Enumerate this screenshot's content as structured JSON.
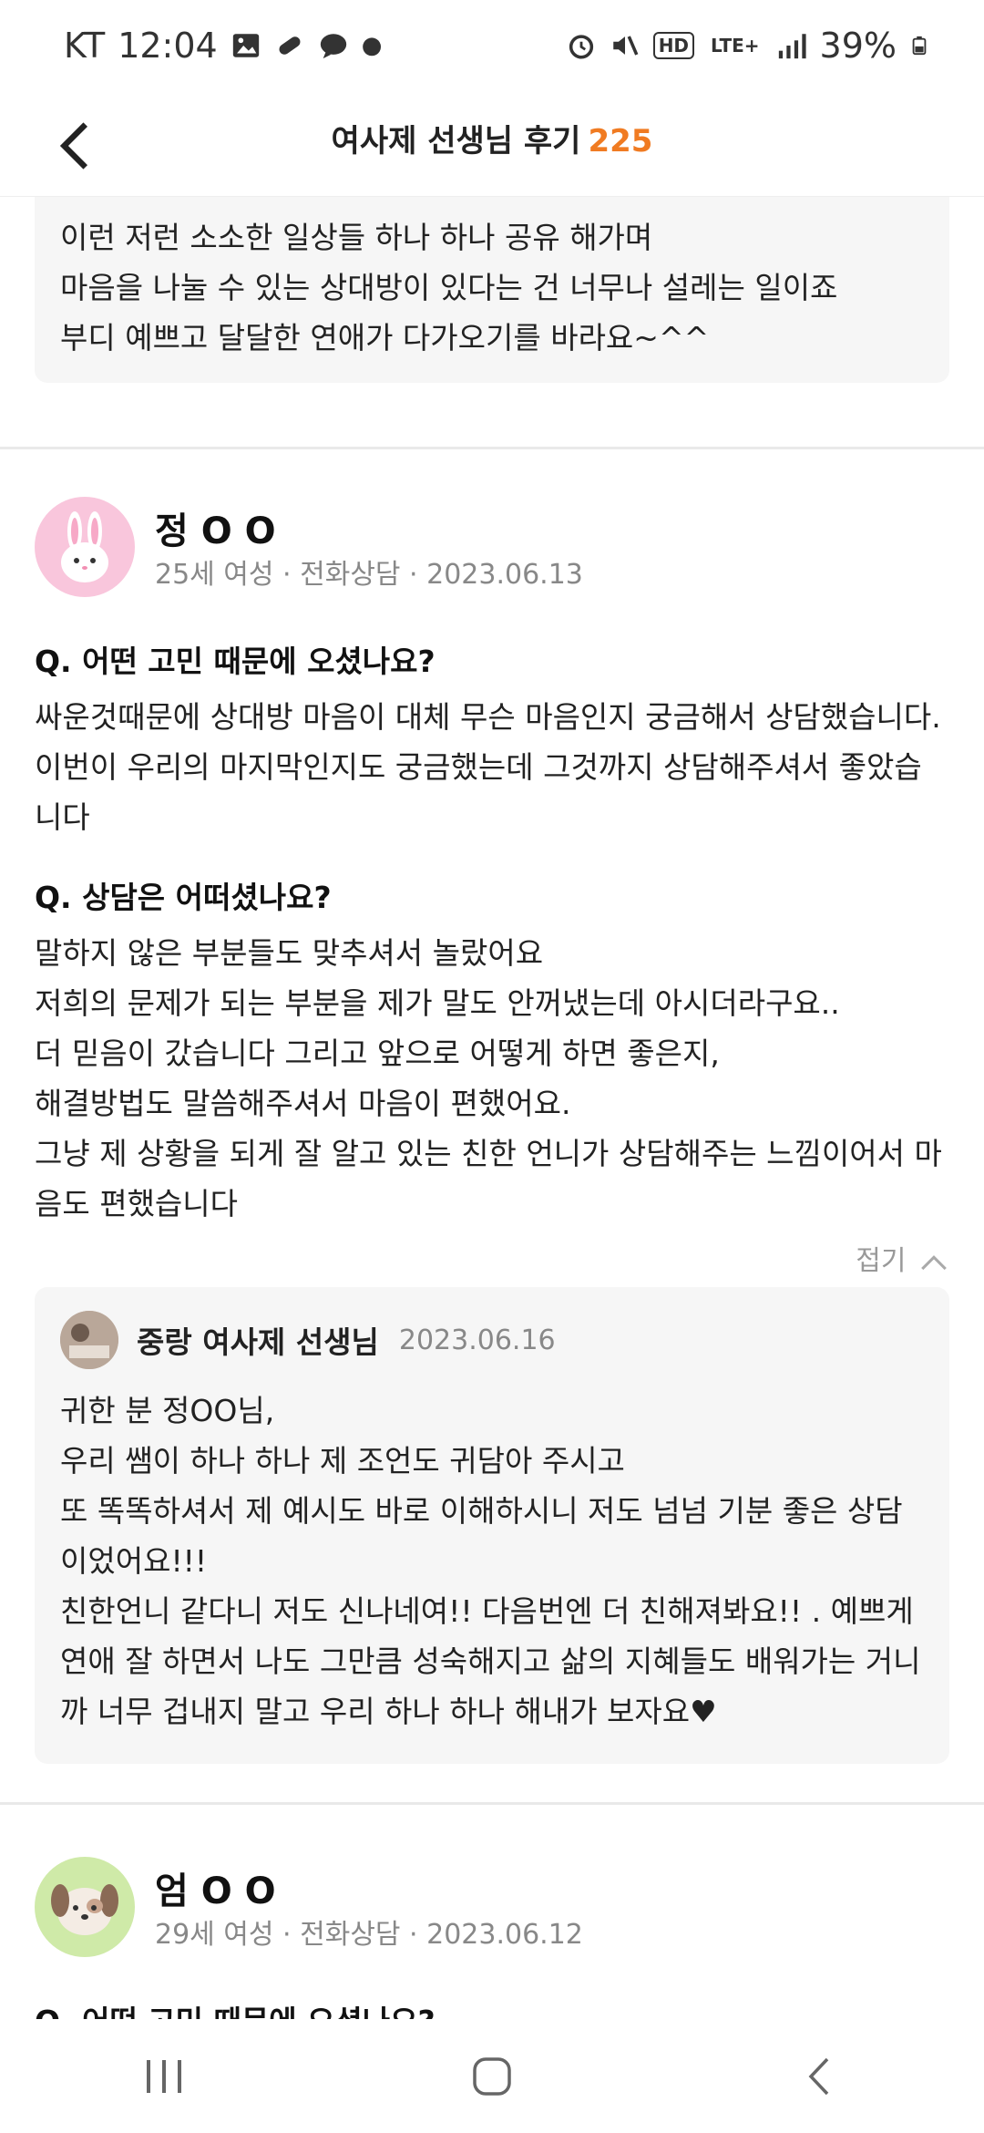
{
  "status_bar": {
    "carrier": "KT",
    "time": "12:04",
    "hd_tag": "HD",
    "lte_tag": "LTE+",
    "battery": "39%"
  },
  "header": {
    "title": "여사제 선생님 후기",
    "count": "225"
  },
  "top_card": {
    "text": "이런 저런 소소한 일상들 하나 하나 공유 해가며\n마음을 나눌 수 있는 상대방이 있다는 건 너무나 설레는 일이죠\n부디 예쁘고 달달한 연애가 다가오기를 바라요~^^"
  },
  "reviews": [
    {
      "name": "정 O O",
      "meta": "25세 여성 · 전화상담 · 2023.06.13",
      "q1_title": "Q. 어떤 고민 때문에 오셨나요?",
      "q1_body": "싸운것때문에 상대방 마음이 대체 무슨 마음인지 궁금해서 상담했습니다. 이번이 우리의 마지막인지도 궁금했는데 그것까지 상담해주셔서 좋았습니다",
      "q2_title": "Q. 상담은 어떠셨나요?",
      "q2_body": "말하지 않은 부분들도 맞추셔서 놀랐어요\n저희의 문제가 되는 부분을 제가 말도 안꺼냈는데 아시더라구요..\n더 믿음이 갔습니다 그리고 앞으로 어떻게 하면 좋은지,\n해결방법도 말씀해주셔서 마음이 편했어요.\n그냥 제 상황을 되게 잘 알고 있는 친한 언니가 상담해주는 느낌이어서 마음도 편했습니다",
      "fold_label": "접기",
      "reply": {
        "author": "중랑 여사제 선생님",
        "date": "2023.06.16",
        "body": "귀한 분 정OO님,\n우리 쌤이 하나 하나 제 조언도 귀담아 주시고\n또 똑똑하셔서 제 예시도 바로 이해하시니 저도 넘넘 기분 좋은 상담이었어요!!!\n친한언니 같다니 저도 신나네여!! 다음번엔 더 친해져봐요!! . 예쁘게 연애 잘 하면서 나도 그만큼 성숙해지고 삶의 지혜들도 배워가는 거니까 너무 겁내지 말고 우리 하나 하나 해내가 보자요♥"
      }
    },
    {
      "name": "엄 O O",
      "meta": "29세 여성 · 전화상담 · 2023.06.12",
      "q1_title": "Q. 어떤 고민 때문에 오셨나요?"
    }
  ],
  "colors": {
    "accent": "#f07b22",
    "card_bg": "#f6f6f6",
    "avatar1_bg": "#f9c6dc",
    "avatar2_bg": "#cfeaa8"
  }
}
